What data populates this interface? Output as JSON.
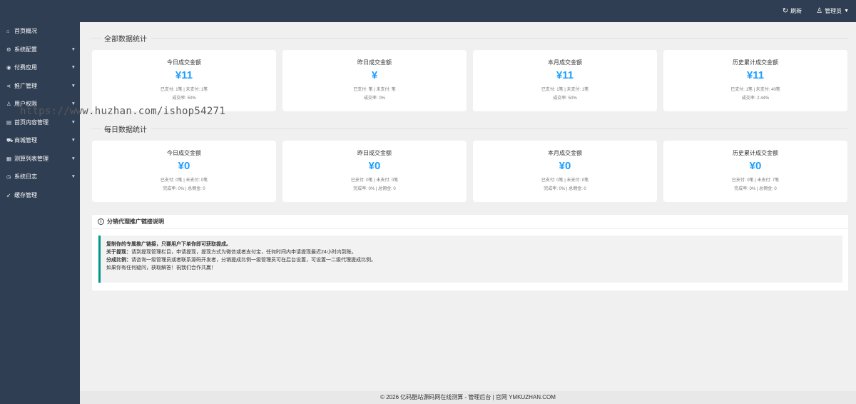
{
  "topbar": {
    "refresh_icon": "refresh-icon",
    "refresh_label": "刷新",
    "user_icon": "user-icon",
    "user_label": "管理员"
  },
  "sidebar": {
    "items": [
      {
        "icon": "home-icon",
        "glyph": "⌂",
        "label": "首页概况",
        "has_caret": false
      },
      {
        "icon": "gear-icon",
        "glyph": "⚙",
        "label": "系统配置",
        "has_caret": true
      },
      {
        "icon": "pay-icon",
        "glyph": "◉",
        "label": "付费应用",
        "has_caret": true
      },
      {
        "icon": "share-icon",
        "glyph": "⋖",
        "label": "推广管理",
        "has_caret": true
      },
      {
        "icon": "user-icon",
        "glyph": "♙",
        "label": "用户权限",
        "has_caret": true
      },
      {
        "icon": "content-icon",
        "glyph": "▤",
        "label": "首页内容管理",
        "has_caret": true
      },
      {
        "icon": "cart-icon",
        "glyph": "⛟",
        "label": "商城管理",
        "has_caret": true
      },
      {
        "icon": "list-icon",
        "glyph": "▦",
        "label": "测算列表管理",
        "has_caret": true
      },
      {
        "icon": "clock-icon",
        "glyph": "◷",
        "label": "系统日志",
        "has_caret": true
      },
      {
        "icon": "send-icon",
        "glyph": "➹",
        "label": "缓存管理",
        "has_caret": false
      }
    ]
  },
  "watermark": "https://www.huzhan.com/ishop54271",
  "sections": {
    "all": {
      "title": "全部数据统计",
      "cards": [
        {
          "title": "今日成交金额",
          "value": "¥11",
          "line1": "已支付: 1笔 | 未支付: 1笔",
          "line2": "成交率: 50%"
        },
        {
          "title": "昨日成交金额",
          "value": "¥",
          "line1": "已支付: 笔 | 未支付: 笔",
          "line2": "成交率: 0%"
        },
        {
          "title": "本月成交金额",
          "value": "¥11",
          "line1": "已支付: 1笔 | 未支付: 1笔",
          "line2": "成交率: 50%"
        },
        {
          "title": "历史累计成交金额",
          "value": "¥11",
          "line1": "已支付: 1笔 | 未支付: 40笔",
          "line2": "成交率: 2.44%"
        }
      ]
    },
    "daily": {
      "title": "每日数据统计",
      "cards": [
        {
          "title": "今日成交金额",
          "value": "¥0",
          "line1": "已支付: 0笔 | 未支付: 0笔",
          "line2": "完成率: 0% | 总佣金: 0"
        },
        {
          "title": "昨日成交金额",
          "value": "¥0",
          "line1": "已支付: 0笔 | 未支付: 0笔",
          "line2": "完成率: 0% | 总佣金: 0"
        },
        {
          "title": "本月成交金额",
          "value": "¥0",
          "line1": "已支付: 0笔 | 未支付: 0笔",
          "line2": "完成率: 0% | 总佣金: 0"
        },
        {
          "title": "历史累计成交金额",
          "value": "¥0",
          "line1": "已支付: 0笔 | 未支付: 7笔",
          "line2": "完成率: 0% | 总佣金: 0"
        }
      ]
    }
  },
  "notice": {
    "title": "分销代理推广链接说明",
    "line1": "复制你的专属推广链接，只要用户下单你即可获取提成。",
    "line2_bold": "关于提现：",
    "line2": "请到提现管理栏目，申请提现，提现方式为微信或者支付宝，任何时间内申请提现最迟24小时内到账。",
    "line3_bold": "分成比例：",
    "line3": "请咨询一级管理员或者联系源码开发者，分销提成比例一级管理员可在后台设置，可设置一二级代理提成比例。",
    "line4": "如果你有任何疑问，获取解答！祝我们合作共赢！"
  },
  "footer": "© 2026 亿码酷站源码网在线测算 - 管理后台 | 官网 YMKUZHAN.COM",
  "colors": {
    "accent": "#1e9fff",
    "sidebar": "#2f3e52",
    "notice_border": "#009688"
  }
}
